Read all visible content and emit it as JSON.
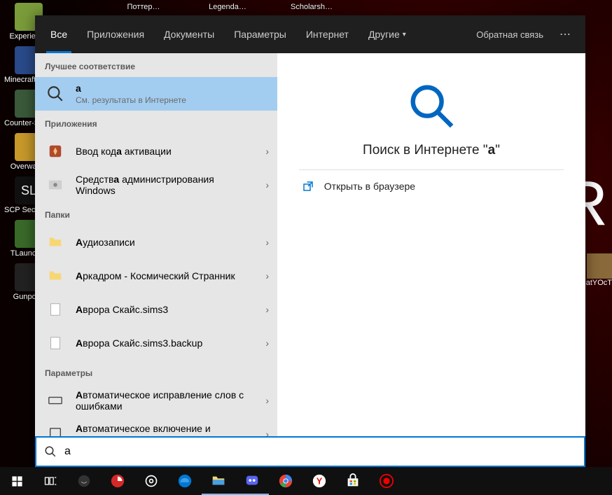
{
  "desktop": {
    "leftIcons": [
      {
        "label": "Experience"
      },
      {
        "label": "Minecraft Story M…"
      },
      {
        "label": "Counter-Strike Sourc…"
      },
      {
        "label": "Overwatch"
      },
      {
        "label": "SCP Secret Laborat…"
      },
      {
        "label": "TLauncher"
      },
      {
        "label": "Gunpoint"
      }
    ],
    "topIcons": [
      {
        "label": "Поттер…"
      },
      {
        "label": "Legenda…"
      },
      {
        "label": "Scholarsh…"
      }
    ],
    "rightThumb": "atYOcT",
    "bigLetter": "R"
  },
  "search": {
    "tabs": [
      {
        "label": "Все",
        "active": true
      },
      {
        "label": "Приложения"
      },
      {
        "label": "Документы"
      },
      {
        "label": "Параметры"
      },
      {
        "label": "Интернет"
      },
      {
        "label": "Другие",
        "hasChevron": true
      }
    ],
    "feedback": "Обратная связь",
    "sections": {
      "bestMatch": "Лучшее соответствие",
      "apps": "Приложения",
      "folders": "Папки",
      "settings": "Параметры"
    },
    "bestMatch": {
      "title": "a",
      "sub": "См. результаты в Интернете"
    },
    "appsList": [
      {
        "title": "Ввод кода активации",
        "highlight": "а"
      },
      {
        "title": "Средства администрирования Windows",
        "highlight": "а"
      }
    ],
    "foldersList": [
      {
        "title": "Аудиозаписи"
      },
      {
        "title": "Аркадром - Космический Странник"
      },
      {
        "title": "Аврора Скайс.sims3"
      },
      {
        "title": "Аврора Скайс.sims3.backup"
      }
    ],
    "settingsList": [
      {
        "title": "Автоматическое исправление слов с ошибками"
      },
      {
        "title": "Автоматическое включение и выключение режима планшета"
      }
    ],
    "preview": {
      "titlePrefix": "Поиск в Интернете ",
      "titleQueryOpen": "\"",
      "titleQuery": "a",
      "titleQueryClose": "\"",
      "action": "Открыть в браузере"
    },
    "inputValue": "a"
  },
  "taskbar": {
    "items": [
      "start",
      "taskview",
      "audio",
      "yandex-red",
      "cortana",
      "edge",
      "explorer",
      "discord",
      "chrome",
      "yandex",
      "store",
      "record"
    ]
  }
}
